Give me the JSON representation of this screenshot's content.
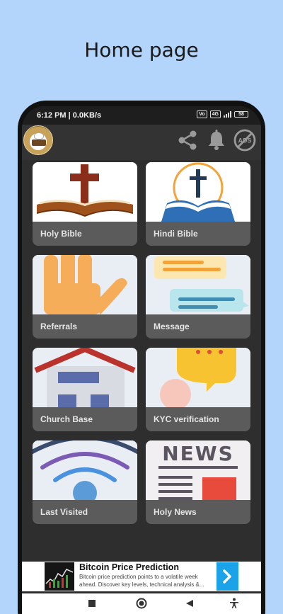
{
  "page_heading": "Home page",
  "status_bar": {
    "time": "6:12 PM | 0.0KB/s",
    "network_badge": "4G",
    "volte_badge": "Vo",
    "battery": "58"
  },
  "app_bar": {
    "logo_icon": "bible-study-logo",
    "share_icon": "share-icon",
    "bell_icon": "notification-bell-icon",
    "ads_icon": "no-ads-icon",
    "ads_text": "ADS"
  },
  "tiles": [
    {
      "label": "Holy Bible",
      "icon": "cross-on-bible-image"
    },
    {
      "label": "Hindi Bible",
      "icon": "cross-over-open-book-image"
    },
    {
      "label": "Referrals",
      "icon": "raised-hand-image"
    },
    {
      "label": "Message",
      "icon": "chat-bubbles-image"
    },
    {
      "label": "Church Base",
      "icon": "house-image"
    },
    {
      "label": "KYC verification",
      "icon": "speech-bubble-image"
    },
    {
      "label": "Last Visited",
      "icon": "wifi-signal-image"
    },
    {
      "label": "Holy News",
      "icon": "newspaper-image"
    }
  ],
  "news_word": "NEWS",
  "ad": {
    "title": "Bitcoin Price Prediction",
    "description": "Bitcoin price prediction points to a volatile week ahead. Discover key levels, technical analysis &..."
  },
  "colors": {
    "background": "#b3d4fb",
    "screen": "#2e2e2e",
    "card_footer": "#5b5b5b",
    "ad_accent": "#1aa3e8"
  }
}
